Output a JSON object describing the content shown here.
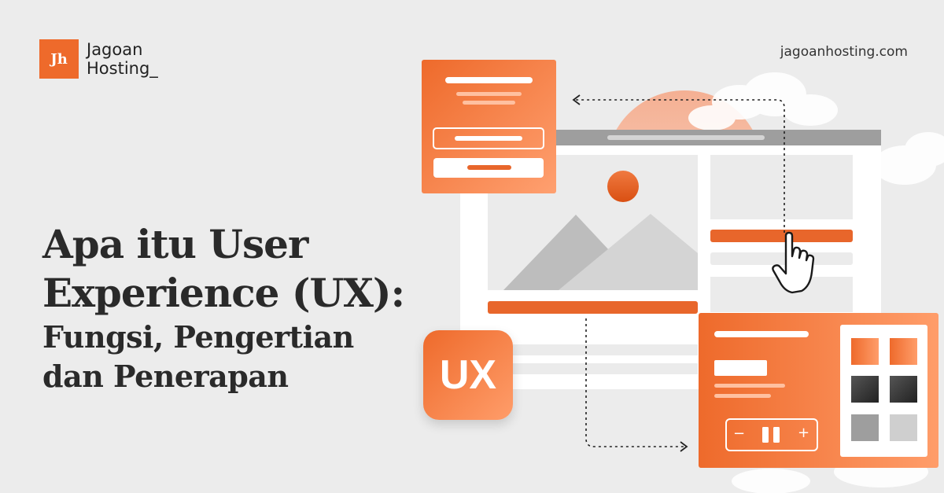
{
  "brand": {
    "mark": "Jh",
    "name_line1": "Jagoan",
    "name_line2": "Hosting_",
    "url": "jagoanhosting.com"
  },
  "headline": {
    "line1": "Apa itu User",
    "line2": "Experience (UX):",
    "line3": "Fungsi, Pengertian",
    "line4": "dan Penerapan"
  },
  "badge": {
    "label": "UX"
  },
  "player": {
    "minus": "−",
    "plus": "+"
  },
  "colors": {
    "accent": "#ee6a2b",
    "accent_light": "#ff9d6a",
    "background": "#ececec",
    "text_dark": "#2a2a2a"
  },
  "icons": [
    "pointer-hand-icon",
    "image-placeholder-icon",
    "pause-icon",
    "minus-icon",
    "plus-icon"
  ]
}
